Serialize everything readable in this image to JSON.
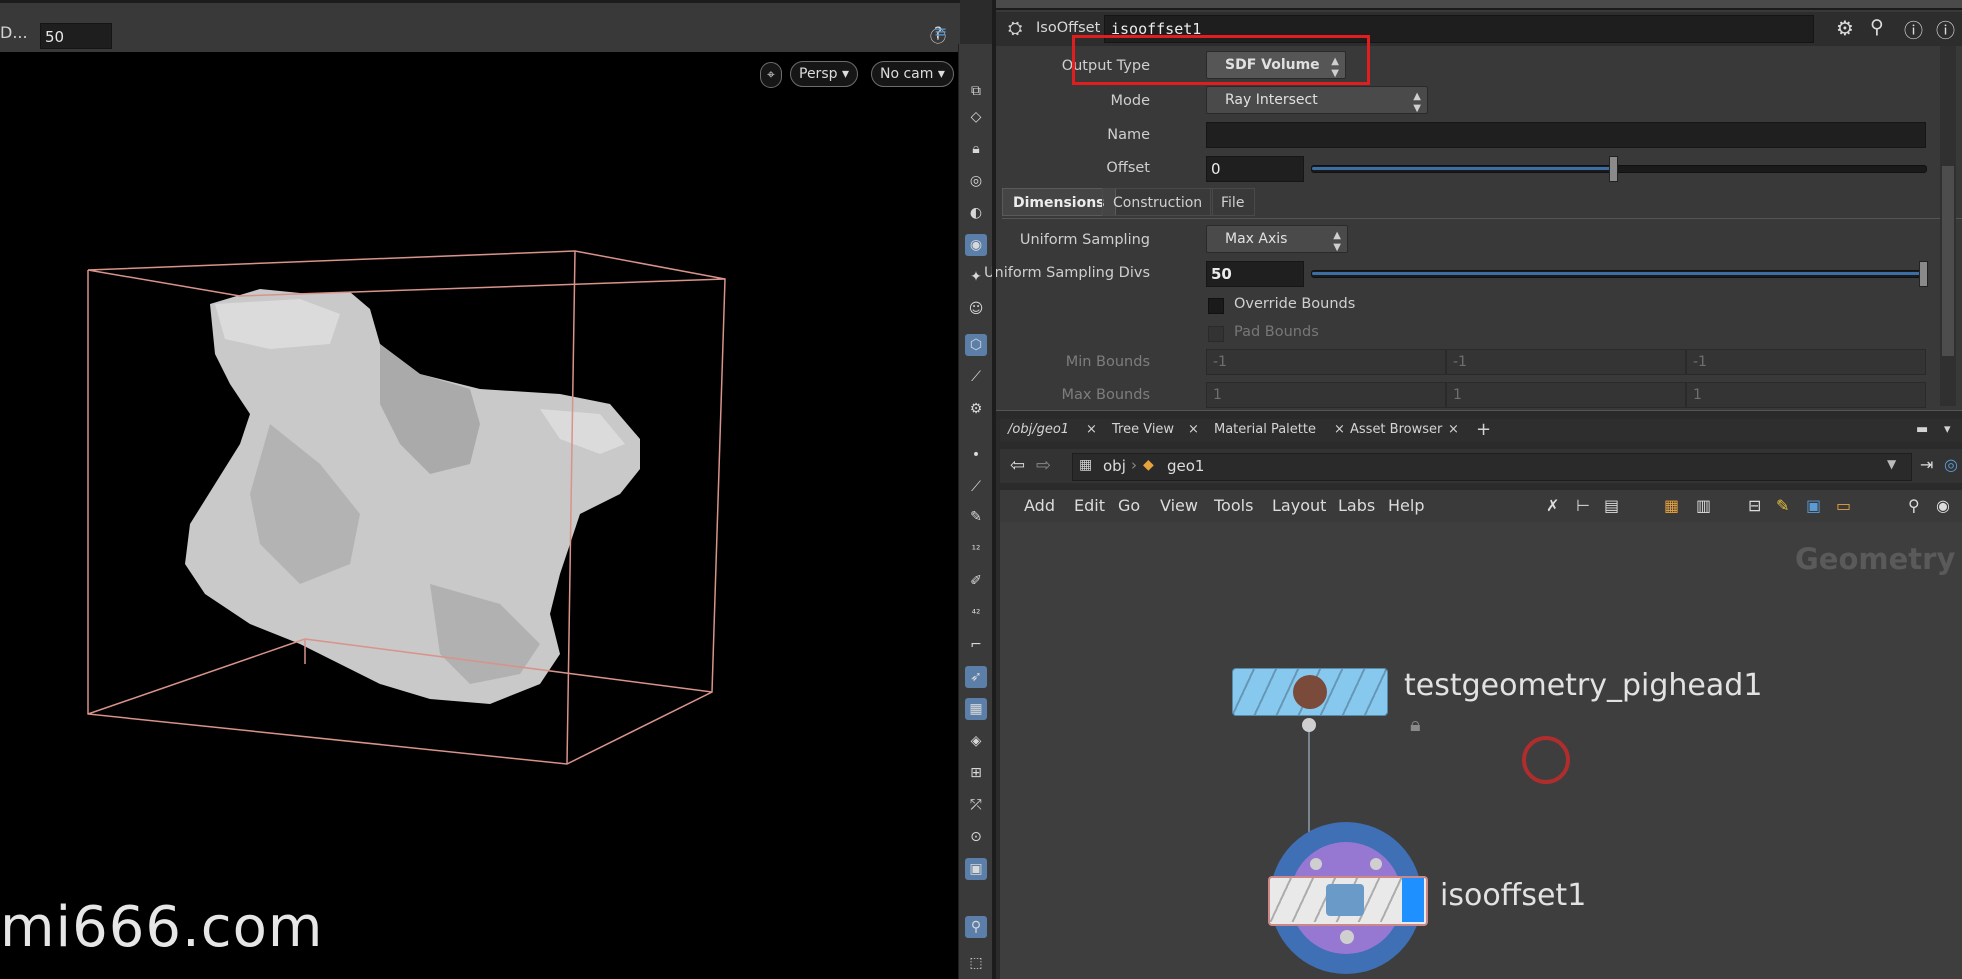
{
  "viewport": {
    "toolbar_label": "D...",
    "toolbar_value": "50",
    "view_mode": "Persp",
    "camera": "No cam",
    "watermark": "mi666.com"
  },
  "param_panel": {
    "node_type": "IsoOffset",
    "node_name": "isooffset1",
    "output_type_label": "Output Type",
    "output_type_value": "SDF Volume",
    "mode_label": "Mode",
    "mode_value": "Ray Intersect",
    "name_label": "Name",
    "name_value": "",
    "offset_label": "Offset",
    "offset_value": "0",
    "offset_slider_fraction": 0.49,
    "tabs": [
      "Dimensions",
      "Construction",
      "File"
    ],
    "uniform_sampling_label": "Uniform Sampling",
    "uniform_sampling_value": "Max Axis",
    "uniform_sampling_divs_label": "Uniform Sampling Divs",
    "uniform_sampling_divs_value": "50",
    "divs_slider_fraction": 1.0,
    "override_bounds_label": "Override Bounds",
    "pad_bounds_label": "Pad Bounds",
    "min_bounds_label": "Min Bounds",
    "min_bounds": [
      "-1",
      "-1",
      "-1"
    ],
    "max_bounds_label": "Max Bounds",
    "max_bounds": [
      "1",
      "1",
      "1"
    ]
  },
  "network": {
    "tabs": [
      "/obj/geo1",
      "Tree View",
      "Material Palette",
      "Asset Browser"
    ],
    "path": [
      "obj",
      "geo1"
    ],
    "menu": [
      "Add",
      "Edit",
      "Go",
      "View",
      "Tools",
      "Layout",
      "Labs",
      "Help"
    ],
    "context_label": "Geometry",
    "nodes": [
      {
        "name": "testgeometry_pighead1"
      },
      {
        "name": "isooffset1"
      }
    ]
  },
  "colors": {
    "highlight_box": "#e01e1e",
    "node_blue": "#87c8ee",
    "selection_ring": "#3f6fb5",
    "bbox_line": "#d8938a"
  }
}
